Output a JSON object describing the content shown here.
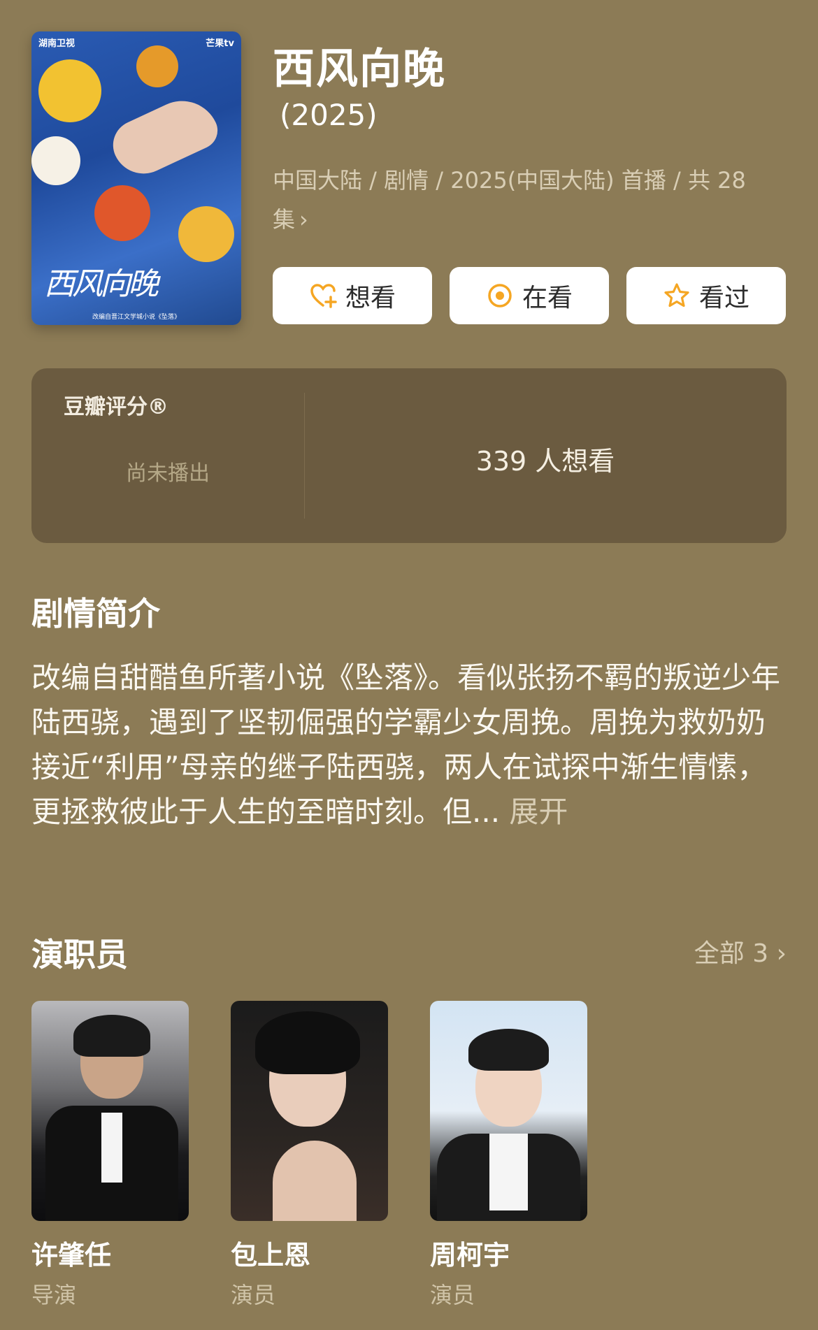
{
  "poster": {
    "brand_left": "湖南卫视",
    "brand_right": "芒果tv",
    "calligraphy": "西风向晚",
    "footer": "改编自晋江文学城小说《坠落》"
  },
  "show": {
    "title": "西风向晚",
    "year": "(2025)",
    "meta": "中国大陆 / 剧情 / 2025(中国大陆) 首播 / 共 28 集",
    "meta_chevron": "›"
  },
  "actions": {
    "want": "想看",
    "watching": "在看",
    "watched": "看过"
  },
  "rating": {
    "label": "豆瓣评分®",
    "status": "尚未播出",
    "wish_count": "339 人想看"
  },
  "synopsis": {
    "heading": "剧情简介",
    "text": "改编自甜醋鱼所著小说《坠落》。看似张扬不羁的叛逆少年陆西骁，遇到了坚韧倔强的学霸少女周挽。周挽为救奶奶接近“利用”母亲的继子陆西骁，两人在试探中渐生情愫，更拯救彼此于人生的至暗时刻。但...",
    "more": "展开"
  },
  "cast": {
    "heading": "演职员",
    "all_label": "全部 3 ›",
    "members": [
      {
        "name": "许肇任",
        "role": "导演"
      },
      {
        "name": "包上恩",
        "role": "演员"
      },
      {
        "name": "周柯宇",
        "role": "演员"
      }
    ]
  },
  "colors": {
    "background": "#8c7b56",
    "rating_panel": "#6b5b40",
    "accent_orange": "#f5a623"
  }
}
